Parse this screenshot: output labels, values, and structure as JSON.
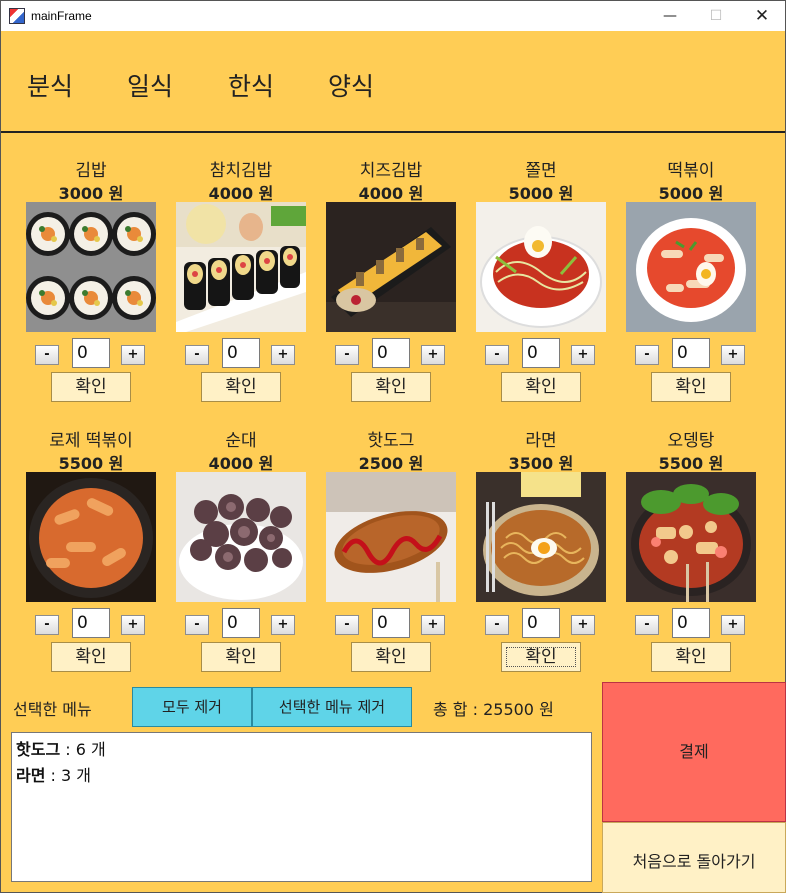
{
  "window": {
    "title": "mainFrame",
    "minimize": "—",
    "maximize": "☐",
    "close": "✕"
  },
  "categories": [
    "분식",
    "일식",
    "한식",
    "양식"
  ],
  "items": [
    {
      "name": "김밥",
      "price": "3000 원",
      "qty": "0",
      "icon": "gimbap-photo"
    },
    {
      "name": "참치김밥",
      "price": "4000 원",
      "qty": "0",
      "icon": "tuna-gimbap-photo"
    },
    {
      "name": "치즈김밥",
      "price": "4000 원",
      "qty": "0",
      "icon": "cheese-gimbap-photo"
    },
    {
      "name": "쫄면",
      "price": "5000 원",
      "qty": "0",
      "icon": "jjolmyeon-photo"
    },
    {
      "name": "떡볶이",
      "price": "5000 원",
      "qty": "0",
      "icon": "tteokbokki-photo"
    },
    {
      "name": "로제 떡볶이",
      "price": "5500 원",
      "qty": "0",
      "icon": "rose-tteokbokki-photo"
    },
    {
      "name": "순대",
      "price": "4000 원",
      "qty": "0",
      "icon": "sundae-photo"
    },
    {
      "name": "핫도그",
      "price": "2500 원",
      "qty": "0",
      "icon": "hotdog-photo"
    },
    {
      "name": "라면",
      "price": "3500 원",
      "qty": "0",
      "icon": "ramen-photo"
    },
    {
      "name": "오뎅탕",
      "price": "5500 원",
      "qty": "0",
      "icon": "odeng-tang-photo"
    }
  ],
  "controls": {
    "minus": "-",
    "plus": "+",
    "confirm": "확인"
  },
  "bottom": {
    "selected_label": "선택한 메뉴",
    "remove_all": "모두 제거",
    "remove_selected": "선택한 메뉴 제거",
    "total_label": "총 합 : 25500 원"
  },
  "order_lines": [
    {
      "name": "핫도그",
      "qty_text": " : 6 개"
    },
    {
      "name": "라면",
      "qty_text": " : 3 개"
    }
  ],
  "pay_button": "결제",
  "back_button": "처음으로 돌아가기",
  "colors": {
    "background": "#ffcd55",
    "pay": "#ff6a5e",
    "remove_buttons": "#5fd4e8",
    "confirm_buttons": "#fff1c6"
  }
}
